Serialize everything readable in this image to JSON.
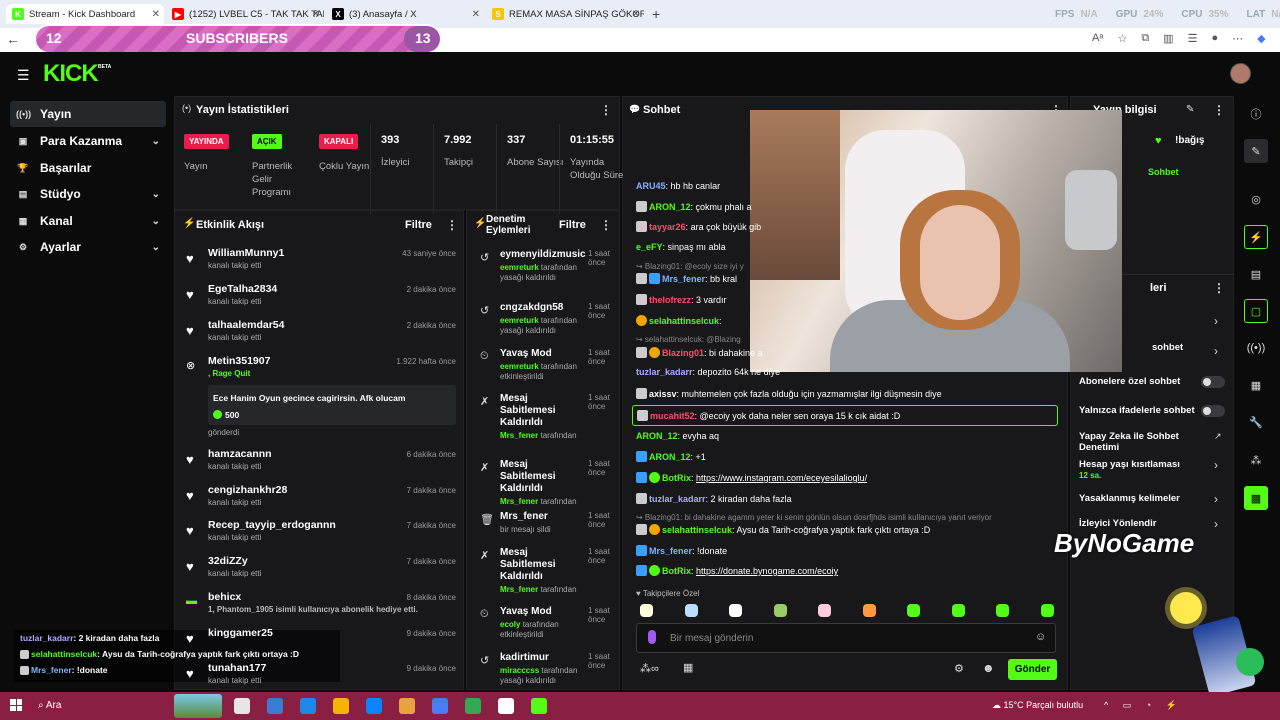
{
  "browser": {
    "tabs": [
      {
        "label": "Stream - Kick Dashboard",
        "color": "#53fc18",
        "glyph": "K"
      },
      {
        "label": "(1252) LVBEL C5 - TAK TAK TAK (1",
        "color": "#ff0000",
        "glyph": "▶"
      },
      {
        "label": "(3) Anasayfa / X",
        "color": "#000000",
        "glyph": "X"
      },
      {
        "label": "REMAX MASA SİNPAŞ GÖKORMA",
        "color": "#f7c600",
        "glyph": "S"
      }
    ],
    "new_tab": "+",
    "stats": {
      "fps_label": "FPS",
      "fps": "N/A",
      "gpu_label": "GPU",
      "gpu": "24%",
      "cpu_label": "CPU",
      "cpu": "35%",
      "lat_label": "LAT",
      "lat": "N/A"
    }
  },
  "subscribers": {
    "left": "12",
    "label": "SUBSCRIBERS",
    "right": "13"
  },
  "header": {
    "logo": "KICK",
    "logo_tag": "BETA"
  },
  "nav": [
    {
      "label": "Yayın",
      "icon": "broadcast-icon",
      "active": true
    },
    {
      "label": "Para Kazanma",
      "icon": "money-icon",
      "chev": true
    },
    {
      "label": "Başarılar",
      "icon": "trophy-icon"
    },
    {
      "label": "Stüdyo",
      "icon": "studio-icon",
      "chev": true
    },
    {
      "label": "Kanal",
      "icon": "channel-icon",
      "chev": true
    },
    {
      "label": "Ayarlar",
      "icon": "settings-icon",
      "chev": true
    }
  ],
  "stats_panel": {
    "title": "Yayın İstatistikleri",
    "badges": [
      {
        "badge": "YAYINDA",
        "label": "Yayın",
        "color": "#e91e4b"
      },
      {
        "badge": "AÇIK",
        "label": "Partnerlik Gelir Programı",
        "color": "#53fc18"
      },
      {
        "badge": "KAPALI",
        "label": "Çoklu Yayın",
        "color": "#e91e4b"
      }
    ],
    "metrics": [
      {
        "value": "393",
        "label": "İzleyici"
      },
      {
        "value": "7.992",
        "label": "Takipçi"
      },
      {
        "value": "337",
        "label": "Abone Sayısı"
      },
      {
        "value": "01:15:55",
        "label": "Yayında Olduğu Süre"
      }
    ]
  },
  "activity": {
    "title": "Etkinlik Akışı",
    "filter": "Filtre",
    "items": [
      {
        "name": "WilliamMunny1",
        "sub": "kanalı takip etti",
        "time": "43 saniye önce"
      },
      {
        "name": "EgeTalha2834",
        "sub": "kanalı takip etti",
        "time": "2 dakika önce"
      },
      {
        "name": "talhaalemdar54",
        "sub": "kanalı takip etti",
        "time": "2 dakika önce"
      },
      {
        "name": "Metin351907",
        "sub": ", Rage Quit",
        "time": "1.922 hafta önce",
        "msg": "Ece Hanim Oyun gecince cagirirsin. Afk olucam",
        "amount": "500",
        "after": "gönderdi"
      },
      {
        "name": "hamzacannn",
        "sub": "kanalı takip etti",
        "time": "6 dakika önce"
      },
      {
        "name": "cengizhankhr28",
        "sub": "kanalı takip etti",
        "time": "7 dakika önce"
      },
      {
        "name": "Recep_tayyip_erdogannn",
        "sub": "kanalı takip etti",
        "time": "7 dakika önce"
      },
      {
        "name": "32diZZy",
        "sub": "kanalı takip etti",
        "time": "7 dakika önce"
      },
      {
        "name": "behicx",
        "sub": "1, Phantom_1905 isimli kullanıcıya abonelik hediye etti.",
        "time": "8 dakika önce"
      },
      {
        "name": "kinggamer25",
        "sub": "",
        "time": "9 dakika önce"
      },
      {
        "name": "tunahan177",
        "sub": "kanalı takip etti",
        "time": "9 dakika önce"
      }
    ]
  },
  "moderation": {
    "title": "Denetim Eylemleri",
    "filter": "Filtre",
    "items": [
      {
        "name": "eymenyildizmusic",
        "time": "1 saat önce",
        "actor": "eemreturk",
        "rest": "tarafından yasağı kaldırıldı"
      },
      {
        "name": "cngzakdgn58",
        "time": "1 saat önce",
        "actor": "eemreturk",
        "rest": "tarafından yasağı kaldırıldı"
      },
      {
        "name": "Yavaş Mod",
        "time": "1 saat önce",
        "actor": "eemreturk",
        "rest": "tarafından etkinleştirildi"
      },
      {
        "name": "Mesaj Sabitlemesi Kaldırıldı",
        "time": "1 saat önce",
        "actor": "Mrs_fener",
        "rest": "tarafından"
      },
      {
        "name": "Mesaj Sabitlemesi Kaldırıldı",
        "time": "1 saat önce",
        "actor": "Mrs_fener",
        "rest": "tarafından"
      },
      {
        "name": "Mrs_fener",
        "time": "1 saat önce",
        "actor": "",
        "rest": "bir mesajı sildi"
      },
      {
        "name": "Mesaj Sabitlemesi Kaldırıldı",
        "time": "1 saat önce",
        "actor": "Mrs_fener",
        "rest": "tarafından"
      },
      {
        "name": "Yavaş Mod",
        "time": "1 saat önce",
        "actor": "ecoly",
        "rest": "tarafından etkinleştirildi"
      },
      {
        "name": "kadirtimur",
        "time": "1 saat önce",
        "actor": "miracccss",
        "rest": "tarafından yasağı kaldırıldı"
      }
    ]
  },
  "chat": {
    "title": "Sohbet",
    "messages": [
      {
        "user": "ARU45",
        "color": "#7fb3ff",
        "text": "hb hb canlar"
      },
      {
        "user": "ARON_12",
        "color": "#53fc18",
        "text": "çokmu phalı a"
      },
      {
        "user": "tayyar26",
        "color": "#ff4d6d",
        "text": "ara çok büyük gib"
      },
      {
        "user": "e_eFY",
        "color": "#53fc18",
        "text": "sinpaş mı abla"
      },
      {
        "user": "Mrs_fener",
        "color": "#7fb3ff",
        "text": "bb kral",
        "reply": "Blazing01: @ecoly size iyi y"
      },
      {
        "user": "thelofrezz",
        "color": "#ff4d6d",
        "text": "3 vardır"
      },
      {
        "user": "selahattinselcuk",
        "color": "#53fc18",
        "text": ""
      },
      {
        "user": "Blazing01",
        "color": "#ff4d6d",
        "text": "bi dahakine a",
        "reply": "selahattinselcuk: @Blazing"
      },
      {
        "user": "tuzlar_kadarr",
        "color": "#aaaaff",
        "text": "depozito 64k ne diye"
      },
      {
        "user": "axissv",
        "color": "#ffffff",
        "text": "muhtemelen çok fazla olduğu için yazmamışlar ilgi düşmesin diye"
      },
      {
        "user": "mucahit52",
        "color": "#ff4d6d",
        "text": "@ecoiy yok daha neler sen oraya 15 k cık aidat :D"
      },
      {
        "user": "ARON_12",
        "color": "#53fc18",
        "text": "evyha aq"
      },
      {
        "user": "ARON_12",
        "color": "#53fc18",
        "text": "+1"
      },
      {
        "user": "BotRix",
        "color": "#53fc18",
        "text": "https://www.instagram.com/eceyesilalioglu/"
      },
      {
        "user": "tuzlar_kadarr",
        "color": "#aaaaff",
        "text": "2 kiradan daha fazla"
      },
      {
        "user": "selahattinselcuk",
        "color": "#53fc18",
        "text": "Aysu da Tarih-coğrafya yaptık fark çıktı ortaya :D",
        "reply": "Blazing01: bi dahakine agamm yeter ki senin gönlün olsun dosrfjhds isimli kullanıcıya yanıt veriyor"
      },
      {
        "user": "Mrs_fener",
        "color": "#7fb3ff",
        "text": "!donate"
      },
      {
        "user": "BotRix",
        "color": "#53fc18",
        "text": "https://donate.bynogame.com/ecoiy"
      }
    ],
    "emote_label": "Takipçilere Özel",
    "input_placeholder": "Bir mesaj gönderin",
    "send": "Gönder"
  },
  "stream_info": {
    "title": "Yayın bilgisi",
    "badges_label": "!bağış",
    "sohbet": "Sohbet",
    "settings_title": "leri",
    "rows": [
      {
        "label": "sohbet",
        "type": "chev"
      },
      {
        "label": "Abonelere özel sohbet",
        "type": "toggle"
      },
      {
        "label": "Yalnızca ifadelerle sohbet",
        "type": "toggle"
      },
      {
        "label": "Yapay Zeka ile Sohbet Denetimi",
        "type": "ext"
      },
      {
        "label": "Hesap yaşı kısıtlaması",
        "sub": "12 sa.",
        "type": "chev"
      },
      {
        "label": "Yasaklanmış kelimeler",
        "type": "chev"
      },
      {
        "label": "İzleyici Yönlendir",
        "type": "chev"
      }
    ]
  },
  "overlay": {
    "brand": "ByNoGame",
    "chat": [
      {
        "user": "tuzlar_kadarr",
        "color": "#aaaaff",
        "text": ": 2 kiradan daha fazla"
      },
      {
        "user": "selahattinselcuk",
        "color": "#53fc18",
        "text": ": Aysu da Tarih-coğrafya yaptık fark çıktı ortaya :D"
      },
      {
        "user": "Mrs_fener",
        "color": "#7fb3ff",
        "text": ": !donate"
      }
    ]
  },
  "taskbar": {
    "search": "Ara",
    "weather": "15°C",
    "weather_text": "Parçalı bulutlu"
  }
}
